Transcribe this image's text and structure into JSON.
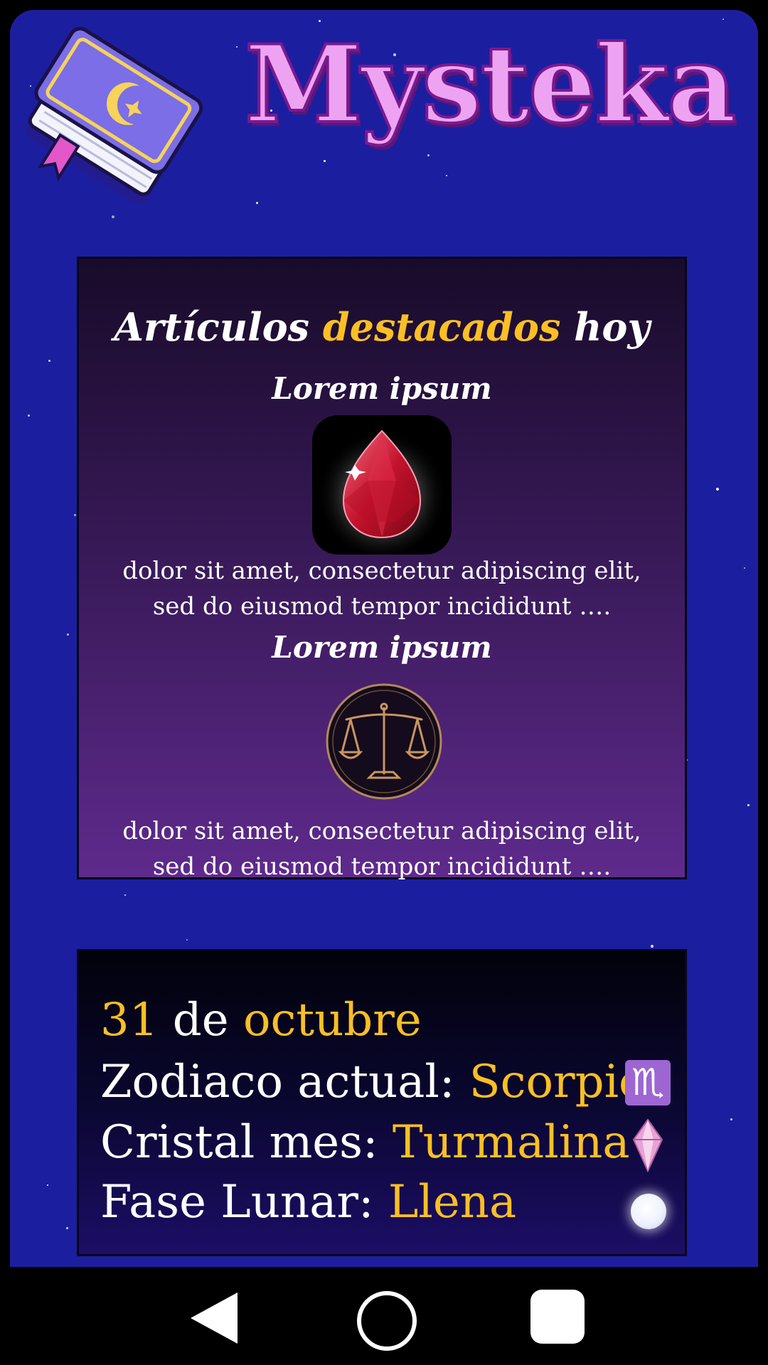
{
  "app": {
    "title": "Mysteka"
  },
  "featured": {
    "title_part1": "Artículos",
    "title_highlight": "destacados",
    "title_part2": "hoy",
    "articles": [
      {
        "title": "Lorem ipsum",
        "image": "ruby-gem-icon",
        "description": "dolor sit amet, consectetur adipiscing elit, sed do eiusmod tempor incididunt …."
      },
      {
        "title": "Lorem ipsum",
        "image": "libra-scales-icon",
        "description": "dolor sit amet, consectetur adipiscing elit, sed do eiusmod tempor incididunt …."
      }
    ]
  },
  "info": {
    "date_day": "31",
    "date_de": "de",
    "date_month": "octubre",
    "zodiac_label": "Zodiaco actual:",
    "zodiac_value": "Scorpio",
    "zodiac_symbol": "♏",
    "crystal_label": "Cristal mes:",
    "crystal_value": "Turmalina",
    "moon_label": "Fase Lunar:",
    "moon_value": "Llena"
  },
  "colors": {
    "background": "#1c1ea0",
    "highlight": "#fbbf24",
    "title": "#eda3f2",
    "title_outline": "#7a1a8f"
  },
  "navbar": {
    "icons": [
      "back-icon",
      "home-icon",
      "recents-icon"
    ]
  }
}
